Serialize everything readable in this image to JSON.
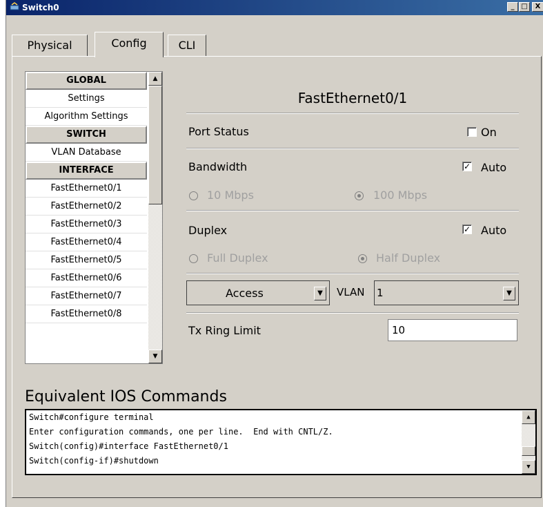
{
  "window": {
    "title": "Switch0",
    "minimize": "_",
    "maximize": "□",
    "close": "X"
  },
  "tabs": [
    {
      "label": "Physical"
    },
    {
      "label": "Config"
    },
    {
      "label": "CLI"
    }
  ],
  "nav": {
    "global_header": "GLOBAL",
    "settings": "Settings",
    "algorithm_settings": "Algorithm Settings",
    "switch_header": "SWITCH",
    "vlan_database": "VLAN Database",
    "interface_header": "INTERFACE",
    "interfaces": [
      "FastEthernet0/1",
      "FastEthernet0/2",
      "FastEthernet0/3",
      "FastEthernet0/4",
      "FastEthernet0/5",
      "FastEthernet0/6",
      "FastEthernet0/7",
      "FastEthernet0/8"
    ],
    "scroll_up": "▲",
    "scroll_down": "▼"
  },
  "panel": {
    "title": "FastEthernet0/1",
    "port_status_label": "Port Status",
    "port_on_label": "On",
    "bandwidth_label": "Bandwidth",
    "bandwidth_auto_label": "Auto",
    "bw_10": "10 Mbps",
    "bw_100": "100 Mbps",
    "duplex_label": "Duplex",
    "duplex_auto_label": "Auto",
    "full_duplex": "Full Duplex",
    "half_duplex": "Half Duplex",
    "mode_value": "Access",
    "vlan_label": "VLAN",
    "vlan_value": "1",
    "tx_ring_label": "Tx Ring Limit",
    "tx_ring_value": "10",
    "check_mark": "✓",
    "dropdown_arrow": "▼"
  },
  "ios": {
    "title": "Equivalent IOS Commands",
    "lines": [
      "Switch#configure terminal",
      "Enter configuration commands, one per line.  End with CNTL/Z.",
      "Switch(config)#interface FastEthernet0/1",
      "Switch(config-if)#shutdown"
    ]
  },
  "colors": {
    "window_bg": "#d4d0c8",
    "titlebar": "#0a246a",
    "disabled_text": "#a0a0a0"
  }
}
